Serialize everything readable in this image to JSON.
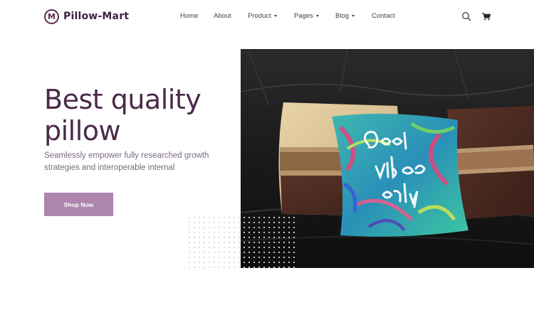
{
  "brand": {
    "name": "Pillow-Mart",
    "logo_letter": "M",
    "color": "#5c2a55"
  },
  "nav": {
    "items": [
      {
        "label": "Home",
        "dropdown": false
      },
      {
        "label": "About",
        "dropdown": false
      },
      {
        "label": "Product",
        "dropdown": true
      },
      {
        "label": "Pages",
        "dropdown": true
      },
      {
        "label": "Blog",
        "dropdown": true
      },
      {
        "label": "Contact",
        "dropdown": false
      }
    ]
  },
  "header_icons": [
    "search-icon",
    "cart-icon"
  ],
  "hero": {
    "title_lines": [
      "Best quality",
      "pillow"
    ],
    "subtitle_lines": [
      "Seamlessly empower fully researched growth",
      "strategies and interoperable internal"
    ],
    "cta_label": "Shop Now",
    "cta_color": "#ad85ad",
    "title_color": "#4a2a48"
  },
  "photo": {
    "pillow_text_lines": [
      "Good",
      "vibes",
      "only"
    ]
  }
}
